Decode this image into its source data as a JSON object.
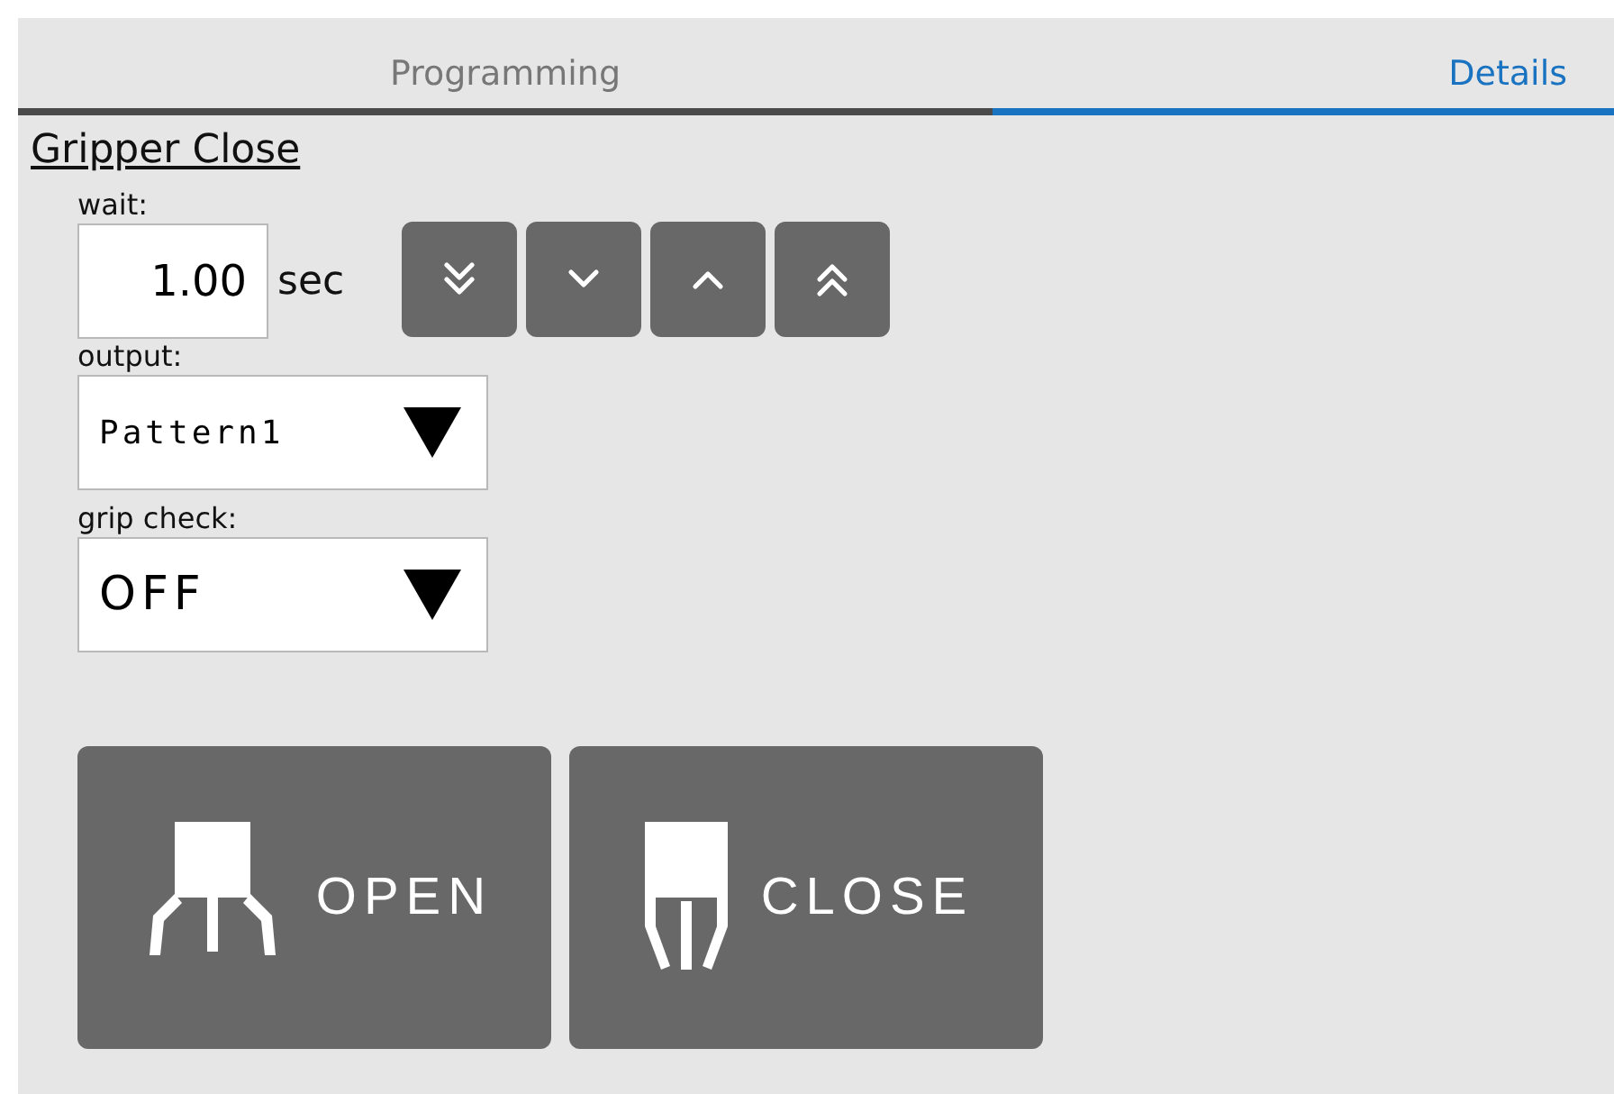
{
  "tabs": [
    {
      "label": "Programming",
      "selected": false
    },
    {
      "label": "Details",
      "selected": true
    }
  ],
  "title": "Gripper Close",
  "wait": {
    "label": "wait:",
    "value": "1.00",
    "unit": "sec"
  },
  "step_buttons": [
    {
      "kind": "double-down"
    },
    {
      "kind": "down"
    },
    {
      "kind": "up"
    },
    {
      "kind": "double-up"
    }
  ],
  "output": {
    "label": "output:",
    "value": "Pattern1"
  },
  "grip_check": {
    "label": "grip check:",
    "value": "OFF"
  },
  "gripper_buttons": [
    {
      "kind": "open",
      "label": "OPEN"
    },
    {
      "kind": "close",
      "label": "CLOSE"
    }
  ]
}
